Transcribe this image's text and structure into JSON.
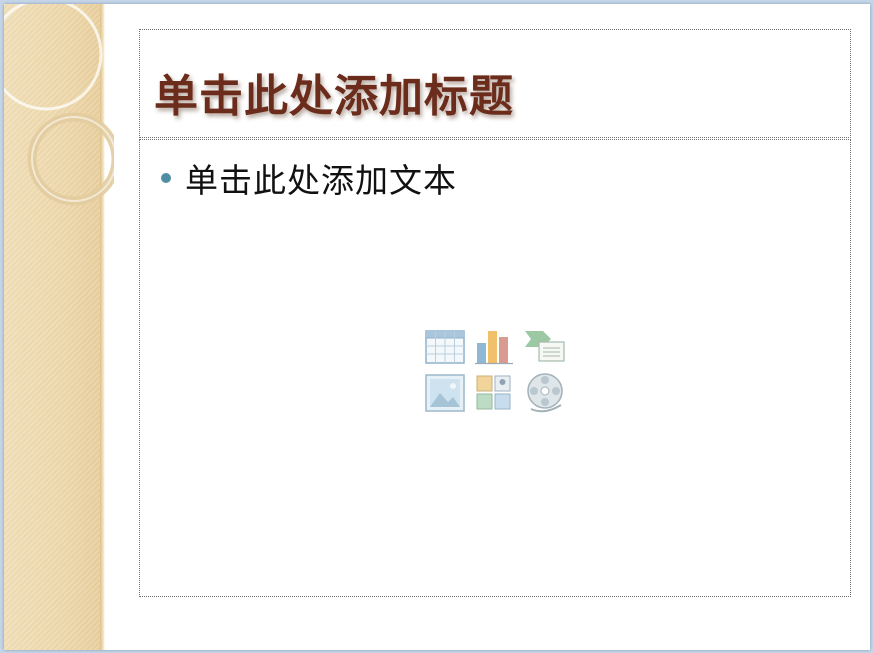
{
  "slide": {
    "title_placeholder": "单击此处添加标题",
    "body_placeholder": "单击此处添加文本"
  },
  "content_insert_icons": [
    "insert-table-icon",
    "insert-chart-icon",
    "insert-smartart-icon",
    "insert-picture-icon",
    "insert-clipart-icon",
    "insert-media-icon"
  ],
  "colors": {
    "title_text": "#6b2c1b",
    "bullet": "#4f8fa6",
    "side_band": "#efd9ad",
    "window_background": "#c5d6e8"
  }
}
